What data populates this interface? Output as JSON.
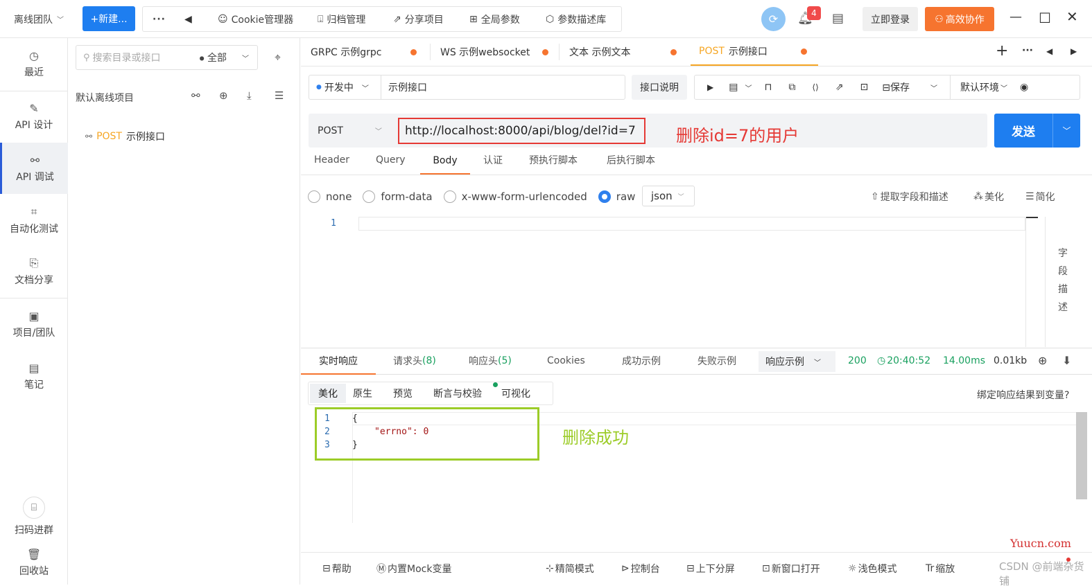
{
  "topbar": {
    "team": "离线团队",
    "new_btn": "+新建...",
    "more": "···",
    "back": "◀",
    "menu": [
      "Cookie管理器",
      "归档管理",
      "分享项目",
      "全局参数",
      "参数描述库"
    ],
    "notif_count": "4",
    "login": "立即登录",
    "collab": "高效协作"
  },
  "nav": {
    "items": [
      {
        "label": "最近",
        "icon": "clock-icon"
      },
      {
        "label": "API 设计",
        "icon": "edit-icon"
      },
      {
        "label": "API 调试",
        "icon": "link-icon"
      },
      {
        "label": "自动化测试",
        "icon": "flow-icon"
      },
      {
        "label": "文档分享",
        "icon": "doc-share-icon"
      },
      {
        "label": "项目/团队",
        "icon": "project-icon"
      },
      {
        "label": "笔记",
        "icon": "note-icon"
      },
      {
        "label": "扫码进群",
        "icon": "qr-icon"
      },
      {
        "label": "回收站",
        "icon": "trash-icon"
      }
    ]
  },
  "tree": {
    "search_placeholder": "搜索目录或接口",
    "filter": "全部",
    "project": "默认离线项目",
    "item_method": "POST",
    "item_name": "示例接口"
  },
  "tabs": [
    {
      "label": "GRPC 示例grpc"
    },
    {
      "label": "WS 示例websocket"
    },
    {
      "label": "文本 示例文本"
    },
    {
      "method": "POST",
      "label": "示例接口"
    }
  ],
  "request": {
    "status": "开发中",
    "name": "示例接口",
    "doc_btn": "接口说明",
    "save": "保存",
    "env": "默认环境",
    "method": "POST",
    "url": "http://localhost:8000/api/blog/del?id=7",
    "annotation": "删除id=7的用户",
    "send": "发送"
  },
  "req_tabs": [
    "Header",
    "Query",
    "Body",
    "认证",
    "预执行脚本",
    "后执行脚本"
  ],
  "body": {
    "modes": [
      "none",
      "form-data",
      "x-www-form-urlencoded",
      "raw"
    ],
    "format": "json",
    "extract": "提取字段和描述",
    "beautify": "美化",
    "simplify": "简化",
    "line1": "1",
    "field_desc": [
      "字",
      "段",
      "描",
      "述"
    ]
  },
  "response": {
    "tabs": [
      "实时响应",
      "请求头",
      "(8)",
      "响应头",
      "(5)",
      "Cookies",
      "成功示例",
      "失败示例"
    ],
    "example": "响应示例",
    "code": "200",
    "time": "20:40:52",
    "duration": "14.00ms",
    "size": "0.01kb",
    "view_tabs": [
      "美化",
      "原生",
      "预览",
      "断言与校验",
      "可视化"
    ],
    "bind": "绑定响应结果到变量?",
    "lines": [
      "1",
      "2",
      "3"
    ],
    "code_lines": [
      "{",
      "\"errno\": 0",
      "}"
    ],
    "annotation": "删除成功"
  },
  "footer": [
    "帮助",
    "内置Mock变量",
    "精简模式",
    "控制台",
    "上下分屏",
    "新窗口打开",
    "浅色模式",
    "缩放"
  ],
  "watermark": "Yuucn.com",
  "watermark2": "CSDN @前端杂货铺"
}
